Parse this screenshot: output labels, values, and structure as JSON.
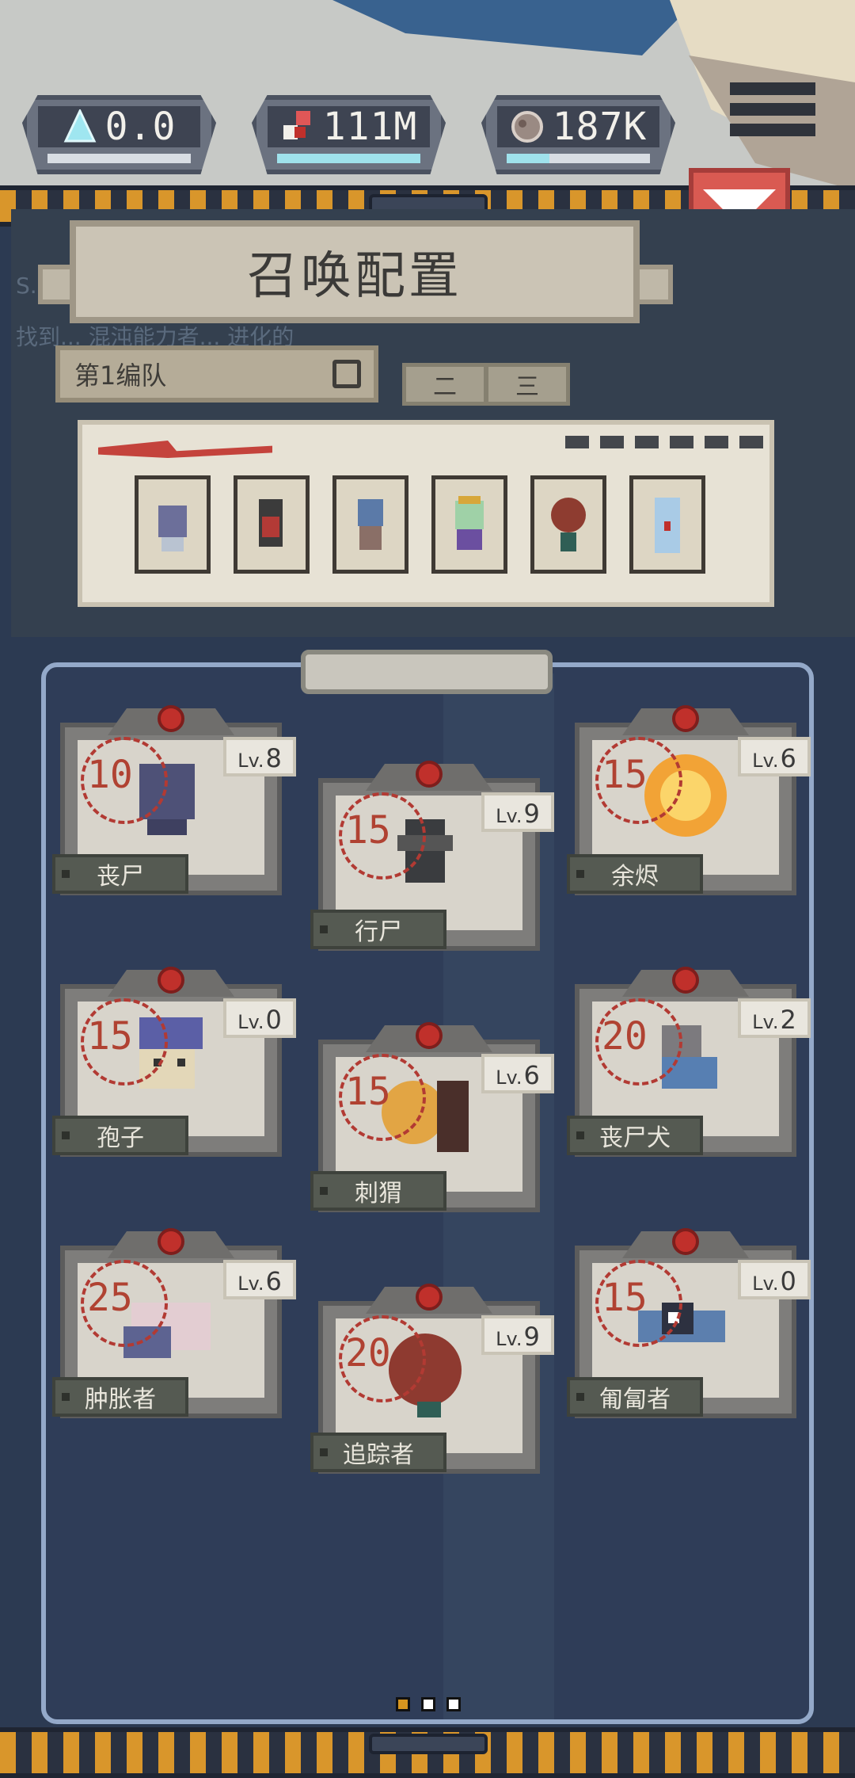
{
  "resources": [
    {
      "id": "crystal",
      "value": "0.0",
      "icon": "crystal-icon",
      "fill": 0
    },
    {
      "id": "blood",
      "value": "111M",
      "icon": "blood-drop-icon",
      "fill": 1
    },
    {
      "id": "flesh",
      "value": "187K",
      "icon": "flesh-icon",
      "fill": 0.3
    }
  ],
  "menu_icon": "hamburger-menu-icon",
  "collapse_icon": "triangle-down-icon",
  "panel": {
    "title": "召唤配置",
    "ghost_line1": "S.O",
    "ghost_line2": "找到... 混沌能力者... 进化的",
    "team_label": "第1编队",
    "team_tabs": [
      "二",
      "三"
    ]
  },
  "formation_slots": [
    "slot-1",
    "slot-2",
    "slot-3",
    "slot-4",
    "slot-5",
    "slot-6"
  ],
  "cards": [
    {
      "name": "丧尸",
      "cost": "10",
      "lv_prefix": "Lv.",
      "lv": "8"
    },
    {
      "name": "行尸",
      "cost": "15",
      "lv_prefix": "Lv.",
      "lv": "9"
    },
    {
      "name": "余烬",
      "cost": "15",
      "lv_prefix": "Lv.",
      "lv": "6"
    },
    {
      "name": "孢子",
      "cost": "15",
      "lv_prefix": "Lv.",
      "lv": "0"
    },
    {
      "name": "刺猬",
      "cost": "15",
      "lv_prefix": "Lv.",
      "lv": "6"
    },
    {
      "name": "丧尸犬",
      "cost": "20",
      "lv_prefix": "Lv.",
      "lv": "2"
    },
    {
      "name": "肿胀者",
      "cost": "25",
      "lv_prefix": "Lv.",
      "lv": "6"
    },
    {
      "name": "追踪者",
      "cost": "20",
      "lv_prefix": "Lv.",
      "lv": "9"
    },
    {
      "name": "匍匐者",
      "cost": "15",
      "lv_prefix": "Lv.",
      "lv": "0"
    }
  ],
  "pager": {
    "current": 1,
    "total": 3
  },
  "colors": {
    "accent": "#d95a52",
    "hazard": "#d9962b",
    "panel": "#2f3d58"
  }
}
